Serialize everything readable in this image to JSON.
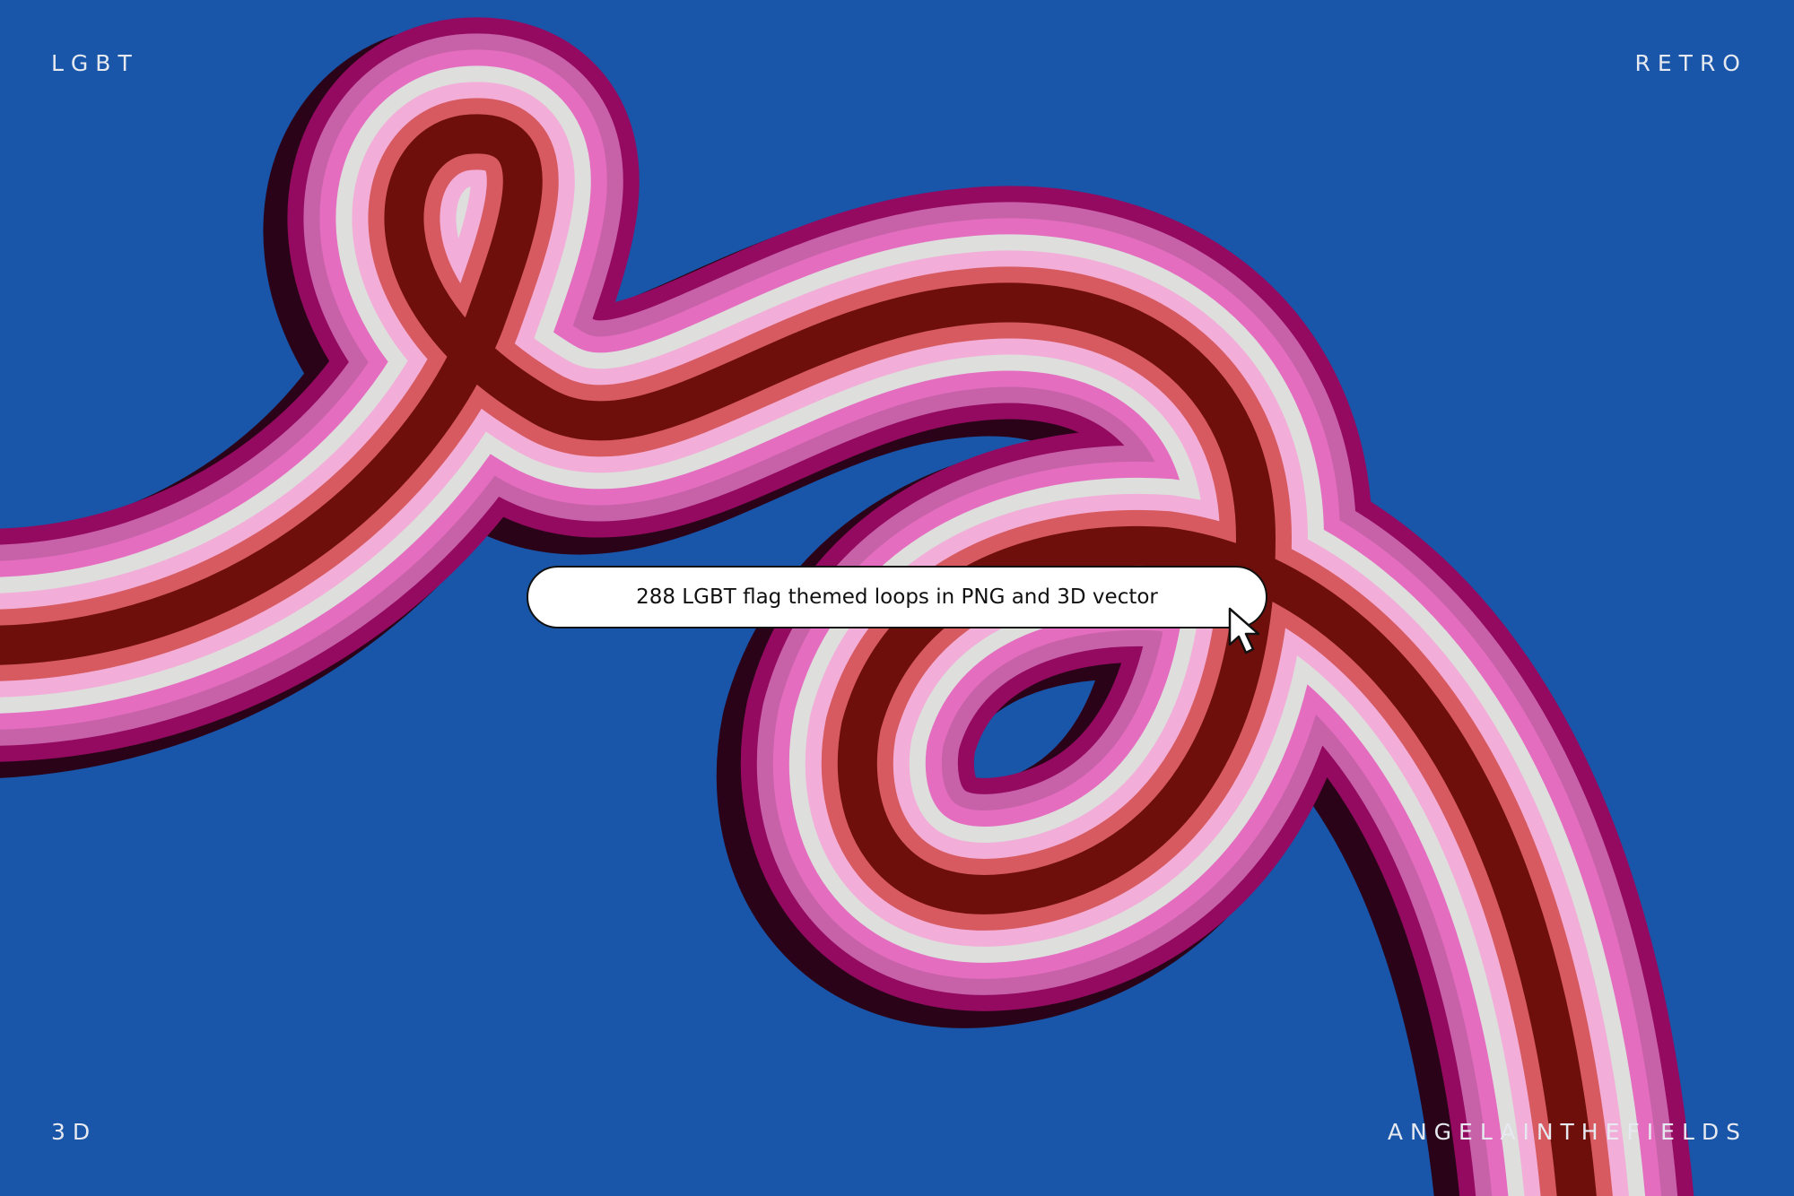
{
  "corners": {
    "top_left": "LGBT",
    "top_right": "RETRO",
    "bottom_left": "3D",
    "bottom_right": "ANGELAINTHEFIELDS"
  },
  "search_pill": {
    "text": "288 LGBT flag themed loops in PNG and 3D vector"
  },
  "icons": {
    "cursor": "mouse-pointer-arrow-icon"
  },
  "colors": {
    "background": "#1955A8",
    "stripes": [
      "#6E0F0B",
      "#D65A60",
      "#F2AED8",
      "#DEDEDC",
      "#E46DC0",
      "#C762A8",
      "#930A60"
    ],
    "shadow": "#2A0318"
  }
}
